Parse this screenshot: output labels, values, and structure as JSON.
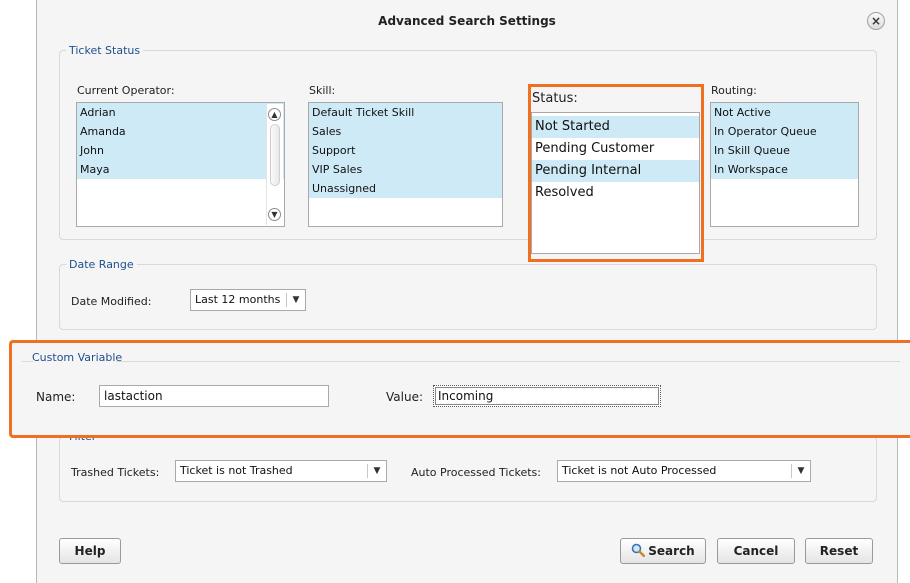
{
  "dialog": {
    "title": "Advanced Search Settings",
    "close_label": "×"
  },
  "ticket_status": {
    "legend": "Ticket Status",
    "operator": {
      "label": "Current Operator:",
      "items": [
        "Adrian",
        "Amanda",
        "John",
        "Maya"
      ]
    },
    "skill": {
      "label": "Skill:",
      "items": [
        "Default Ticket Skill",
        "Sales",
        "Support",
        "VIP Sales",
        "Unassigned"
      ]
    },
    "status": {
      "label": "Status:",
      "items": [
        "Not Started",
        "Pending Customer",
        "Pending Internal",
        "Resolved"
      ]
    },
    "routing": {
      "label": "Routing:",
      "items": [
        "Not Active",
        "In Operator Queue",
        "In Skill Queue",
        "In Workspace"
      ]
    }
  },
  "date_range": {
    "legend": "Date Range",
    "date_modified_label": "Date Modified:",
    "date_modified_value": "Last 12 months"
  },
  "custom_variable": {
    "legend": "Custom Variable",
    "name_label": "Name:",
    "name_value": "lastaction",
    "value_label": "Value:",
    "value_value": "Incoming"
  },
  "filter": {
    "legend": "Filter",
    "trashed_label": "Trashed Tickets:",
    "trashed_value": "Ticket is not Trashed",
    "auto_label": "Auto Processed Tickets:",
    "auto_value": "Ticket is not Auto Processed"
  },
  "buttons": {
    "help": "Help",
    "search": "Search",
    "cancel": "Cancel",
    "reset": "Reset"
  },
  "colors": {
    "highlight": "#f07022",
    "selection": "#cfeaf7",
    "legend_text": "#1f4e8c"
  },
  "icons": {
    "search_button": "magnifier-icon",
    "close": "close-icon",
    "dropdown": "chevron-down-icon"
  }
}
